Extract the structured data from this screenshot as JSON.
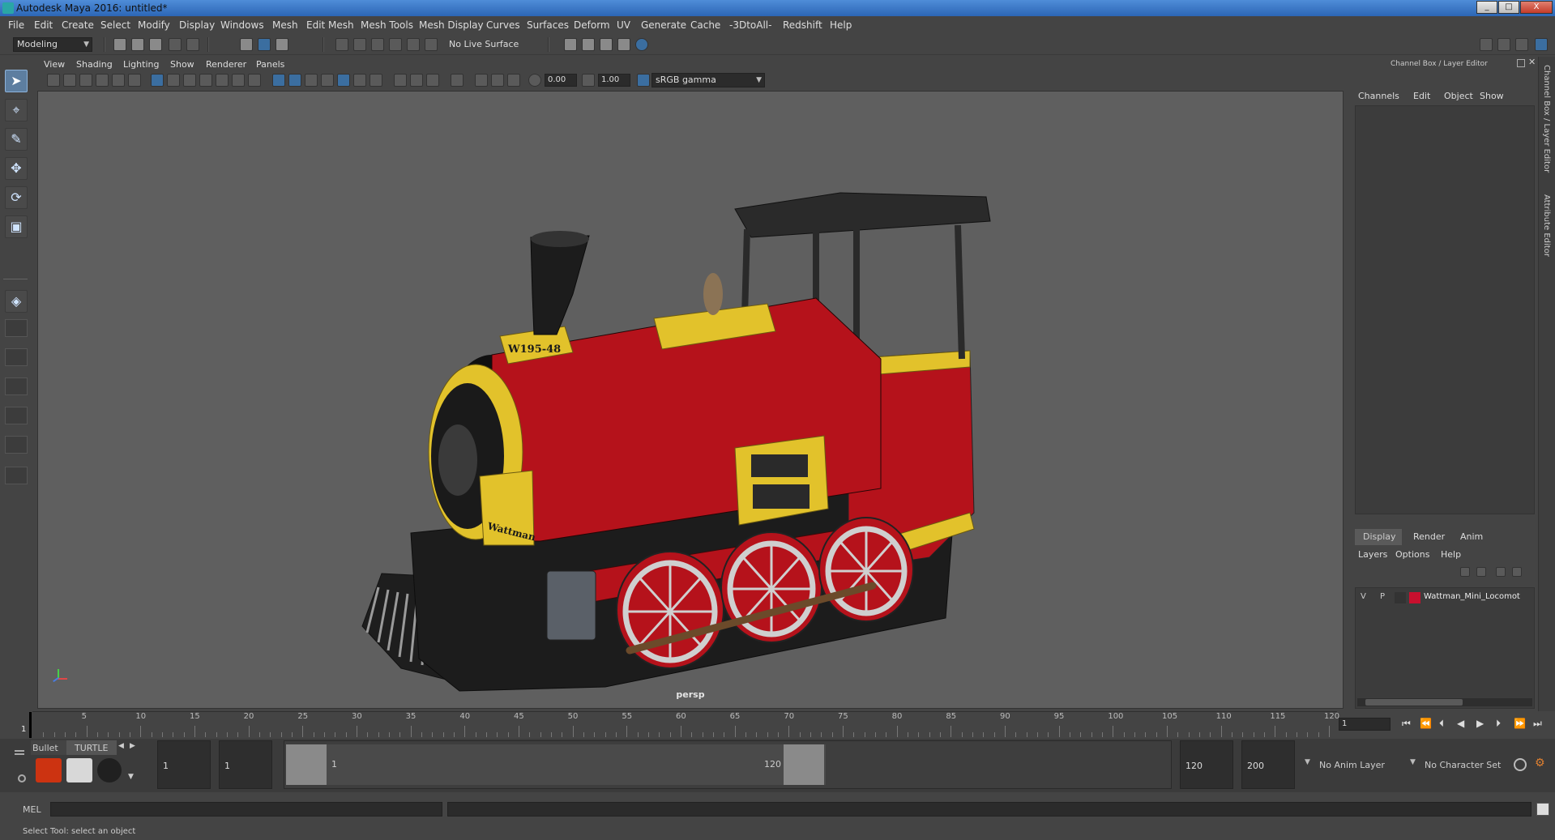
{
  "window": {
    "title": "Autodesk Maya 2016: untitled*",
    "minimize": "_",
    "maximize": "□",
    "close": "X"
  },
  "menubar": [
    "File",
    "Edit",
    "Create",
    "Select",
    "Modify",
    "Display",
    "Windows",
    "Mesh",
    "Edit Mesh",
    "Mesh Tools",
    "Mesh Display",
    "Curves",
    "Surfaces",
    "Deform",
    "UV",
    "Generate",
    "Cache",
    "-3DtoAll-",
    "Redshift",
    "Help"
  ],
  "shelf": {
    "mode": "Modeling",
    "live_surface": "No Live Surface"
  },
  "viewport": {
    "menus": [
      "View",
      "Shading",
      "Lighting",
      "Show",
      "Renderer",
      "Panels"
    ],
    "exposure": "0.00",
    "gamma": "1.00",
    "color_space": "sRGB gamma",
    "camera_label": "persp",
    "model_badge": "W195-48",
    "model_brand": "Wattman"
  },
  "right_panel": {
    "header": "Channel Box / Layer Editor",
    "channel_menus": [
      "Channels",
      "Edit",
      "Object",
      "Show"
    ],
    "layer_tabs": [
      "Display",
      "Render",
      "Anim"
    ],
    "layer_menus": [
      "Layers",
      "Options",
      "Help"
    ],
    "layer": {
      "visible": "V",
      "playback": "P",
      "name": "Wattman_Mini_Locomot",
      "color": "#c8102e"
    },
    "side_tabs": [
      "Channel Box / Layer Editor",
      "Attribute Editor"
    ]
  },
  "timeline": {
    "ticks": [
      "5",
      "10",
      "15",
      "20",
      "25",
      "30",
      "35",
      "40",
      "45",
      "50",
      "55",
      "60",
      "65",
      "70",
      "75",
      "80",
      "85",
      "90",
      "95",
      "100",
      "105",
      "110",
      "115",
      "120"
    ],
    "start_marker": "1",
    "current_frame": "1"
  },
  "range": {
    "shelf_tabs": [
      "Bullet",
      "TURTLE"
    ],
    "start_field": "1",
    "start_inner": "1",
    "range_start": "1",
    "range_end": "120",
    "end_field": "120",
    "max_field": "200",
    "anim_layer": "No Anim Layer",
    "char_set": "No Character Set"
  },
  "command": {
    "label": "MEL"
  },
  "status": {
    "help_text": "Select Tool: select an object"
  }
}
